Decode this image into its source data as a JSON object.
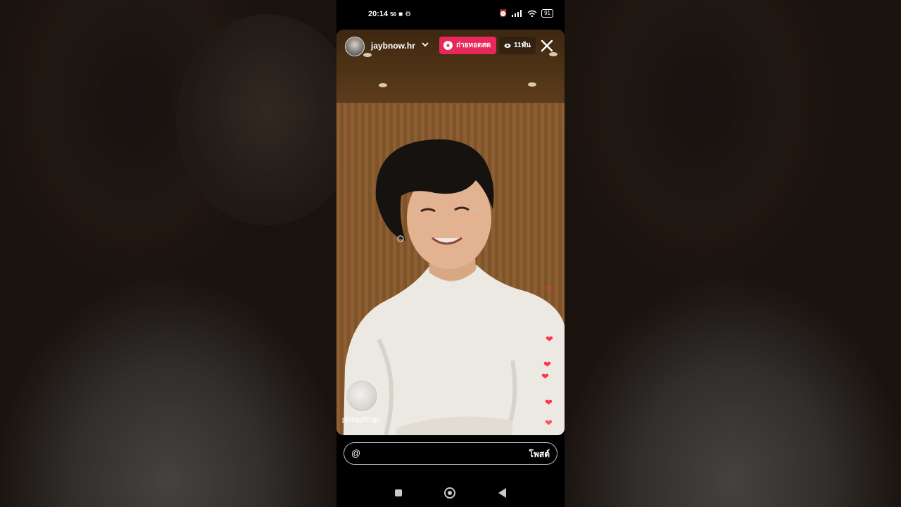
{
  "status_bar": {
    "time": "20:14",
    "seconds": "56",
    "battery": "91"
  },
  "live": {
    "username": "jaybnow.hr",
    "live_label": "ถ่ายทอดสด",
    "viewer_count": "11พัน"
  },
  "guest": {
    "name": "phingphingn"
  },
  "comment": {
    "at_symbol": "@",
    "input_value": "",
    "post_label": "โพสต์"
  },
  "colors": {
    "live_accent": "#e8275a",
    "heart": "#ff3347"
  },
  "icons": {
    "chevron": "chevron-down-icon",
    "eye": "eye-icon",
    "close": "close-icon",
    "heart": "heart-icon"
  }
}
